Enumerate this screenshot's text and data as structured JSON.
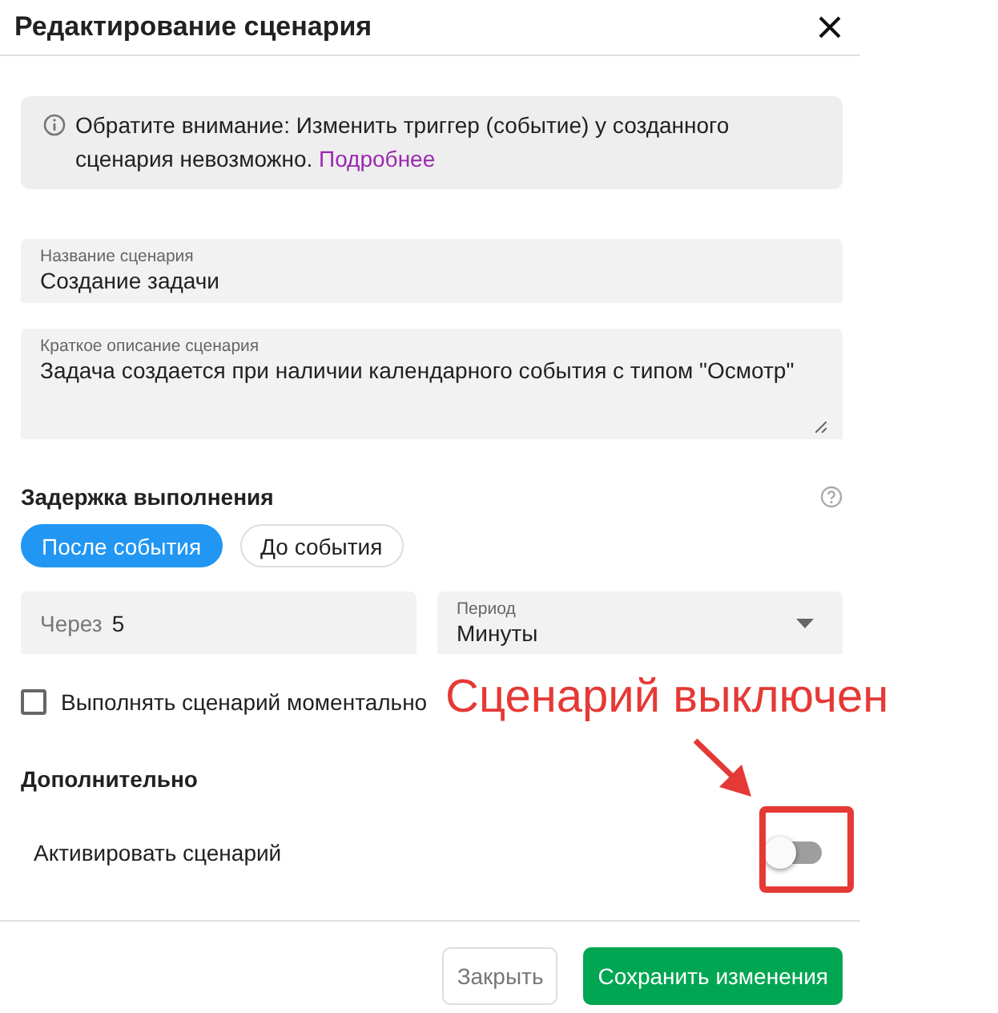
{
  "dialog": {
    "title": "Редактирование сценария"
  },
  "notice": {
    "text": "Обратите внимание: Изменить триггер (событие) у созданного сценария невозможно.",
    "link": "Подробнее"
  },
  "fields": [
    {
      "kind": "input",
      "label": "Название сценария",
      "value": "Создание задачи"
    },
    {
      "kind": "textarea",
      "label": "Краткое описание сценария",
      "value": "Задача создается при наличии календарного события с типом \"Осмотр\""
    }
  ],
  "delay": {
    "title": "Задержка выполнения",
    "options": [
      {
        "label": "После события",
        "selected": true
      },
      {
        "label": "До события",
        "selected": false
      }
    ],
    "after": {
      "label": "Через",
      "value": "5"
    },
    "period": {
      "label": "Период",
      "value": "Минуты"
    },
    "instant": {
      "label": "Выполнять сценарий моментально",
      "checked": false
    }
  },
  "additional": {
    "title": "Дополнительно",
    "activate": {
      "label": "Активировать сценарий",
      "on": false
    }
  },
  "buttons": [
    {
      "kind": "secondary",
      "label": "Закрыть"
    },
    {
      "kind": "primary",
      "label": "Сохранить изменения"
    }
  ],
  "annotation": {
    "text": "Сценарий выключен"
  }
}
